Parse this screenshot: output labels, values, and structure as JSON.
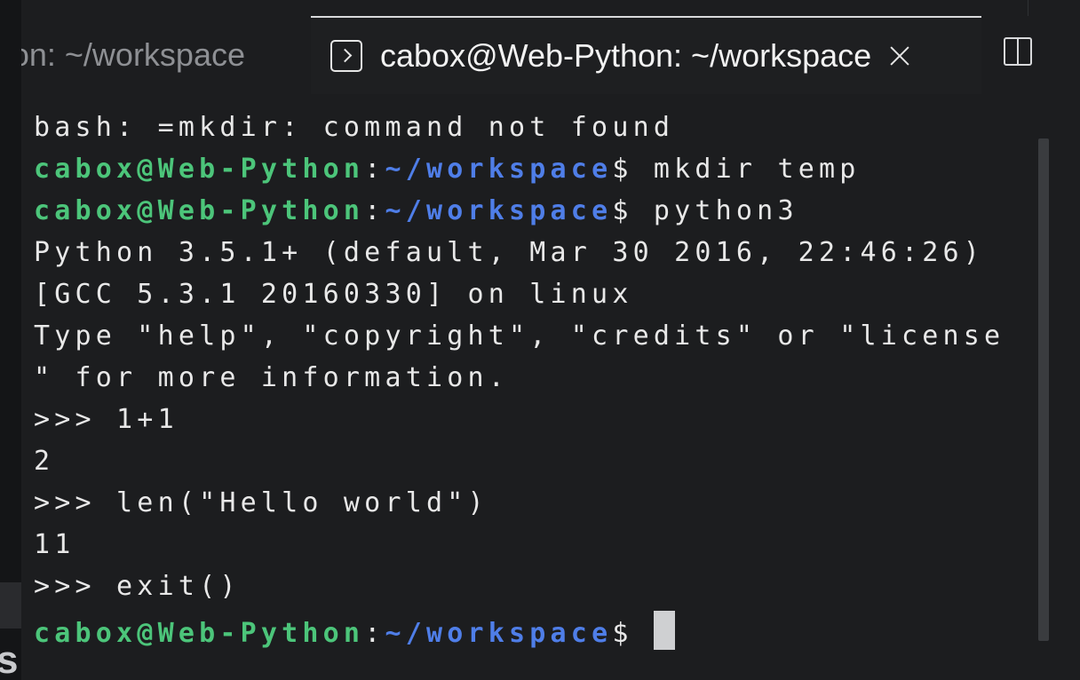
{
  "tabs": [
    {
      "label": "cabox@Web-Python: ~/workspace",
      "active": false
    },
    {
      "label": "cabox@Web-Python: ~/workspace",
      "active": true
    }
  ],
  "icons": {
    "terminal_tab": "terminal-icon",
    "close": "close-icon",
    "split": "split-editor-icon"
  },
  "prompt": {
    "user": "cabox@Web-Python",
    "colon": ":",
    "path": "~/workspace",
    "dollar": "$"
  },
  "terminal": {
    "line0": "bash: =mkdir: command not found",
    "cmd1": " mkdir temp",
    "cmd2": " python3",
    "line3": "Python 3.5.1+ (default, Mar 30 2016, 22:46:26)",
    "line4": "[GCC 5.3.1 20160330] on linux",
    "line5": "Type \"help\", \"copyright\", \"credits\" or \"license",
    "line6": "\" for more information.",
    "line7": ">>> 1+1",
    "line8": "2",
    "line9": ">>> len(\"Hello world\")",
    "line10": "11",
    "line11": ">>> exit()",
    "cmd12": " "
  },
  "left_edge_letter": "s",
  "colors": {
    "background": "#1c1d1f",
    "prompt_user": "#4cc57a",
    "prompt_path": "#4f7ee8",
    "text": "#e8e8e8"
  }
}
